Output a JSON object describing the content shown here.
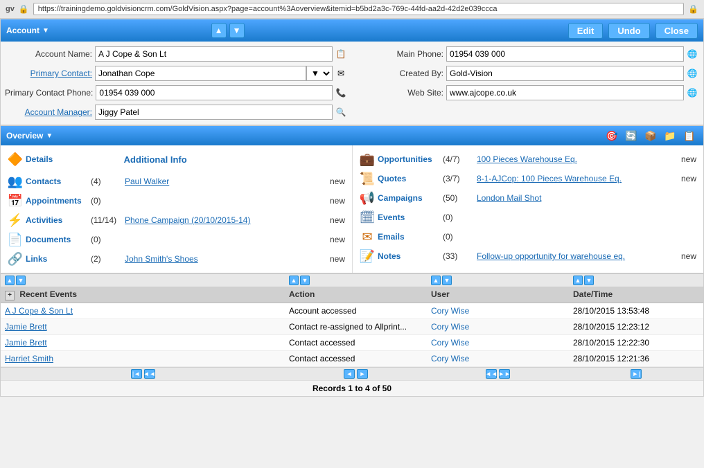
{
  "browser": {
    "url": "https://trainingdemo.goldvisioncrm.com/GoldVision.aspx?page=account%3Aoverview&itemid=b5bd2a3c-769c-44fd-aa2d-42d2e039ccca"
  },
  "header": {
    "title": "Account",
    "edit_btn": "Edit",
    "undo_btn": "Undo",
    "close_btn": "Close"
  },
  "form": {
    "account_name_label": "Account Name:",
    "account_name_value": "A J Cope & Son Lt",
    "primary_contact_label": "Primary Contact:",
    "primary_contact_value": "Jonathan Cope",
    "primary_contact_phone_label": "Primary Contact Phone:",
    "primary_contact_phone_value": "01954 039 000",
    "account_manager_label": "Account Manager:",
    "account_manager_value": "Jiggy Patel",
    "main_phone_label": "Main Phone:",
    "main_phone_value": "01954 039 000",
    "created_by_label": "Created By:",
    "created_by_value": "Gold-Vision",
    "web_site_label": "Web Site:",
    "web_site_value": "www.ajcope.co.uk"
  },
  "overview": {
    "title": "Overview",
    "icons": [
      "🎯",
      "🔄",
      "📦",
      "📁",
      "📋"
    ]
  },
  "sections": {
    "left": {
      "details_label": "Details",
      "additional_info_label": "Additional Info",
      "contacts_label": "Contacts",
      "contacts_count": "(4)",
      "contacts_link": "Paul Walker",
      "contacts_new": "new",
      "appointments_label": "Appointments",
      "appointments_count": "(0)",
      "appointments_new": "new",
      "activities_label": "Activities",
      "activities_count": "(11/14)",
      "activities_link": "Phone Campaign (20/10/2015-14)",
      "activities_new": "new",
      "documents_label": "Documents",
      "documents_count": "(0)",
      "documents_new": "new",
      "links_label": "Links",
      "links_count": "(2)",
      "links_link": "John Smith's Shoes",
      "links_new": "new"
    },
    "right": {
      "opportunities_label": "Opportunities",
      "opportunities_count": "(4/7)",
      "opportunities_link": "100 Pieces Warehouse Eq.",
      "opportunities_new": "new",
      "quotes_label": "Quotes",
      "quotes_count": "(3/7)",
      "quotes_link": "8-1-AJCop: 100 Pieces Warehouse Eq.",
      "quotes_new": "new",
      "campaigns_label": "Campaigns",
      "campaigns_count": "(50)",
      "campaigns_link": "London Mail Shot",
      "events_label": "Events",
      "events_count": "(0)",
      "emails_label": "Emails",
      "emails_count": "(0)",
      "notes_label": "Notes",
      "notes_count": "(33)",
      "notes_link": "Follow-up opportunity for warehouse eq.",
      "notes_new": "new"
    }
  },
  "table": {
    "section_label": "Recent Events",
    "columns": {
      "event": "Event",
      "action": "Action",
      "user": "User",
      "datetime": "Date/Time"
    },
    "rows": [
      {
        "event": "A J Cope & Son Lt",
        "event_link": true,
        "action": "Account accessed",
        "user": "Cory Wise",
        "datetime": "28/10/2015 13:53:48"
      },
      {
        "event": "Jamie Brett",
        "event_link": true,
        "action": "Contact re-assigned to Allprint...",
        "user": "Cory Wise",
        "datetime": "28/10/2015 12:23:12"
      },
      {
        "event": "Jamie Brett",
        "event_link": true,
        "action": "Contact accessed",
        "user": "Cory Wise",
        "datetime": "28/10/2015 12:22:30"
      },
      {
        "event": "Harriet Smith",
        "event_link": true,
        "action": "Contact accessed",
        "user": "Cory Wise",
        "datetime": "28/10/2015 12:21:36"
      }
    ],
    "records_info": "Records 1 to 4 of 50"
  }
}
